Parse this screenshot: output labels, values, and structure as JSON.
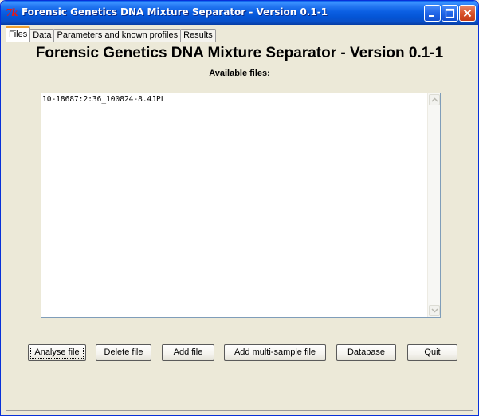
{
  "window": {
    "title": "Forensic Genetics DNA Mixture Separator - Version 0.1-1",
    "icon": "Tk-app-icon",
    "icon_text": "7k",
    "controls": {
      "minimize": "minimize-icon",
      "maximize": "maximize-icon",
      "close": "close-icon"
    }
  },
  "tabs": [
    {
      "label": "Files",
      "active": true
    },
    {
      "label": "Data",
      "active": false
    },
    {
      "label": "Parameters and known profiles",
      "active": false
    },
    {
      "label": "Results",
      "active": false
    }
  ],
  "files_panel": {
    "heading": "Forensic Genetics DNA Mixture Separator - Version 0.1-1",
    "subheading": "Available files:",
    "files": [
      "10-18687:2:36_100824-8.4JPL"
    ]
  },
  "buttons": {
    "analyse": "Analyse file",
    "delete": "Delete file",
    "add": "Add file",
    "add_multi": "Add multi-sample file",
    "database": "Database",
    "quit": "Quit"
  },
  "colors": {
    "titlebar": "#0454D4",
    "window_bg": "#ECE9D8",
    "active_tab_accent": "#F0A030",
    "close_button": "#D9532B"
  }
}
